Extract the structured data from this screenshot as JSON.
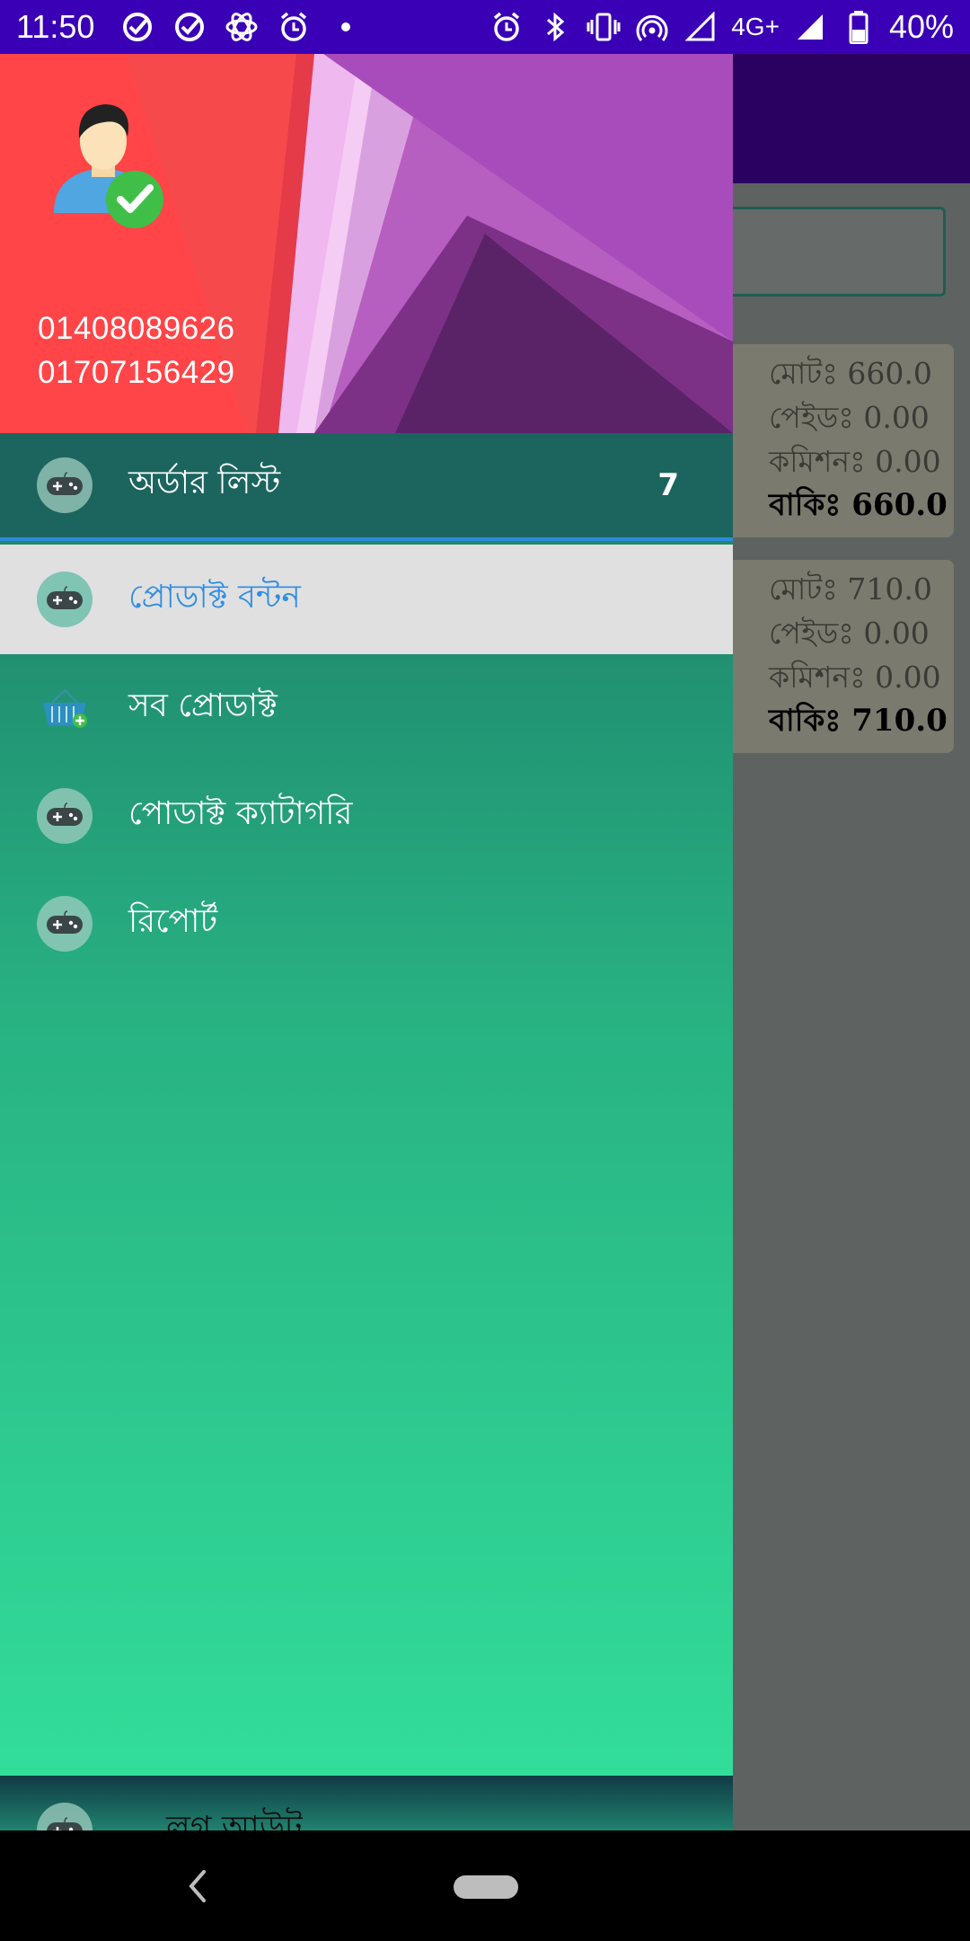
{
  "status_bar": {
    "time": "11:50",
    "network": "4G+",
    "battery": "40%",
    "left_icons": [
      "check-circle-icon",
      "check-circle-icon",
      "atom-icon",
      "alarm-icon",
      "dot-icon"
    ],
    "right_icons": [
      "alarm-icon",
      "bluetooth-icon",
      "vibrate-icon",
      "hotspot-icon",
      "signal-icon",
      "signal-icon",
      "battery-icon"
    ]
  },
  "drawer": {
    "header": {
      "phone_1": "01408089626",
      "phone_2": "01707156429"
    },
    "menu": [
      {
        "label": "অর্ডার লিস্ট",
        "count": "7",
        "icon": "gamepad-icon"
      },
      {
        "label": "প্রোডাক্ট বন্টন",
        "icon": "gamepad-icon"
      },
      {
        "label": "সব প্রোডাক্ট",
        "icon": "basket-icon"
      },
      {
        "label": "পোডাক্ট ক্যাটাগরি",
        "icon": "gamepad-icon"
      },
      {
        "label": "রিপোর্ট",
        "icon": "gamepad-icon"
      }
    ],
    "logout_label": "লগ আউট"
  },
  "background": {
    "cards": [
      {
        "total": "মোটঃ 660.0",
        "paid": "পেইডঃ 0.00",
        "commission": "কমিশনঃ 0.00",
        "due": "বাকিঃ 660.0"
      },
      {
        "total": "মোটঃ 710.0",
        "paid": "পেইডঃ 0.00",
        "commission": "কমিশনঃ 0.00",
        "due": "বাকিঃ 710.0"
      }
    ]
  },
  "colors": {
    "status_bar": "#3a00b6",
    "accent_blue": "#2f8de4",
    "drawer_top": "#1b6a64",
    "drawer_bottom": "#33e09c"
  }
}
